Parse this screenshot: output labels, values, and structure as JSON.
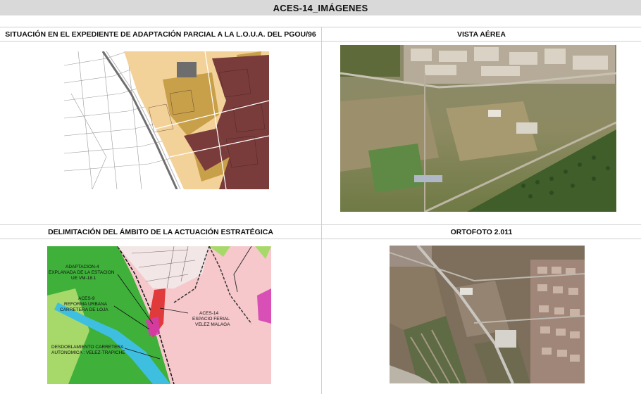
{
  "document": {
    "title": "ACES-14_IMÁGENES"
  },
  "panels": [
    {
      "heading": "SITUACIÓN EN EL EXPEDIENTE DE ADAPTACIÓN PARCIAL A LA L.O.U.A. DEL PGOU/96",
      "image": "zoning-plan-map"
    },
    {
      "heading": "VISTA AÉREA",
      "image": "aerial-oblique-photo"
    },
    {
      "heading": "DELIMITACIÓN DEL ÁMBITO DE LA ACTUACIÓN ESTRATÉGICA",
      "image": "delimitation-map"
    },
    {
      "heading": "ORTOFOTO 2.011",
      "image": "orthophoto"
    }
  ],
  "delimitation_labels": {
    "adaptacion_1": "ADAPTACION-4",
    "adaptacion_2": "EXPLANADA DE LA ESTACION",
    "adaptacion_3": "UE VM-18.1",
    "aces9_1": "ACES-9",
    "aces9_2": "REFORMA URBANA",
    "aces9_3": "CARRETERA DE LOJA",
    "aces14_1": "ACES-14",
    "aces14_2": "ESPACIO FERIAL",
    "aces14_3": "VELEZ MALAGA",
    "desdobl_1": "DESDOBLAMIENTO CARRETERA",
    "desdobl_2": "AUTONOMICA : VELEZ-TRAPICHE"
  },
  "colors": {
    "title_bg": "#d9d9d9",
    "grid_line": "#cfcfcf",
    "plan_urban": "#7a3b3b",
    "plan_expansion": "#f3d29a",
    "plan_ochre": "#c9a04a",
    "delim_green": "#3fb03a",
    "delim_light_green": "#a7d86a",
    "delim_pink": "#f6c8cc",
    "delim_river": "#3fbfe0",
    "delim_red": "#e03a3a",
    "delim_magenta": "#d23bb0"
  }
}
